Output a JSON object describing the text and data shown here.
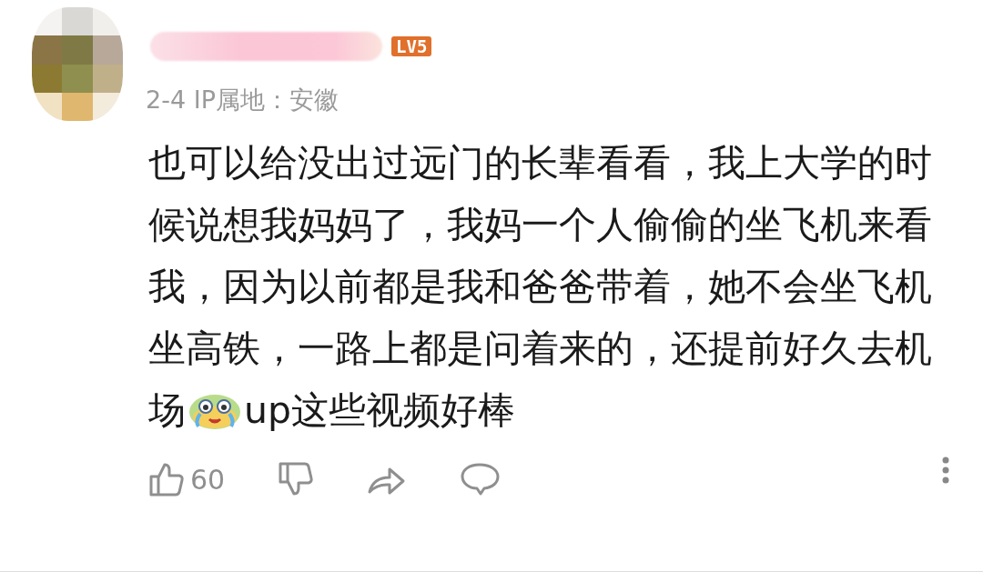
{
  "comment": {
    "level_badge": "LV5",
    "meta": "2-4 IP属地：安徽",
    "body": [
      {
        "kind": "text",
        "text": "也可以给没出过远门的长辈看看，我上大学的时候说想我妈妈了，我妈一个人偷偷的坐飞机来看我，因为以前都是我和爸爸带着，她不会坐飞机坐高铁，一路上都是问着来的，还提前好久去机场"
      },
      {
        "kind": "emoji"
      },
      {
        "kind": "text",
        "text": "up这些视频好棒"
      }
    ],
    "like_count": "60"
  }
}
